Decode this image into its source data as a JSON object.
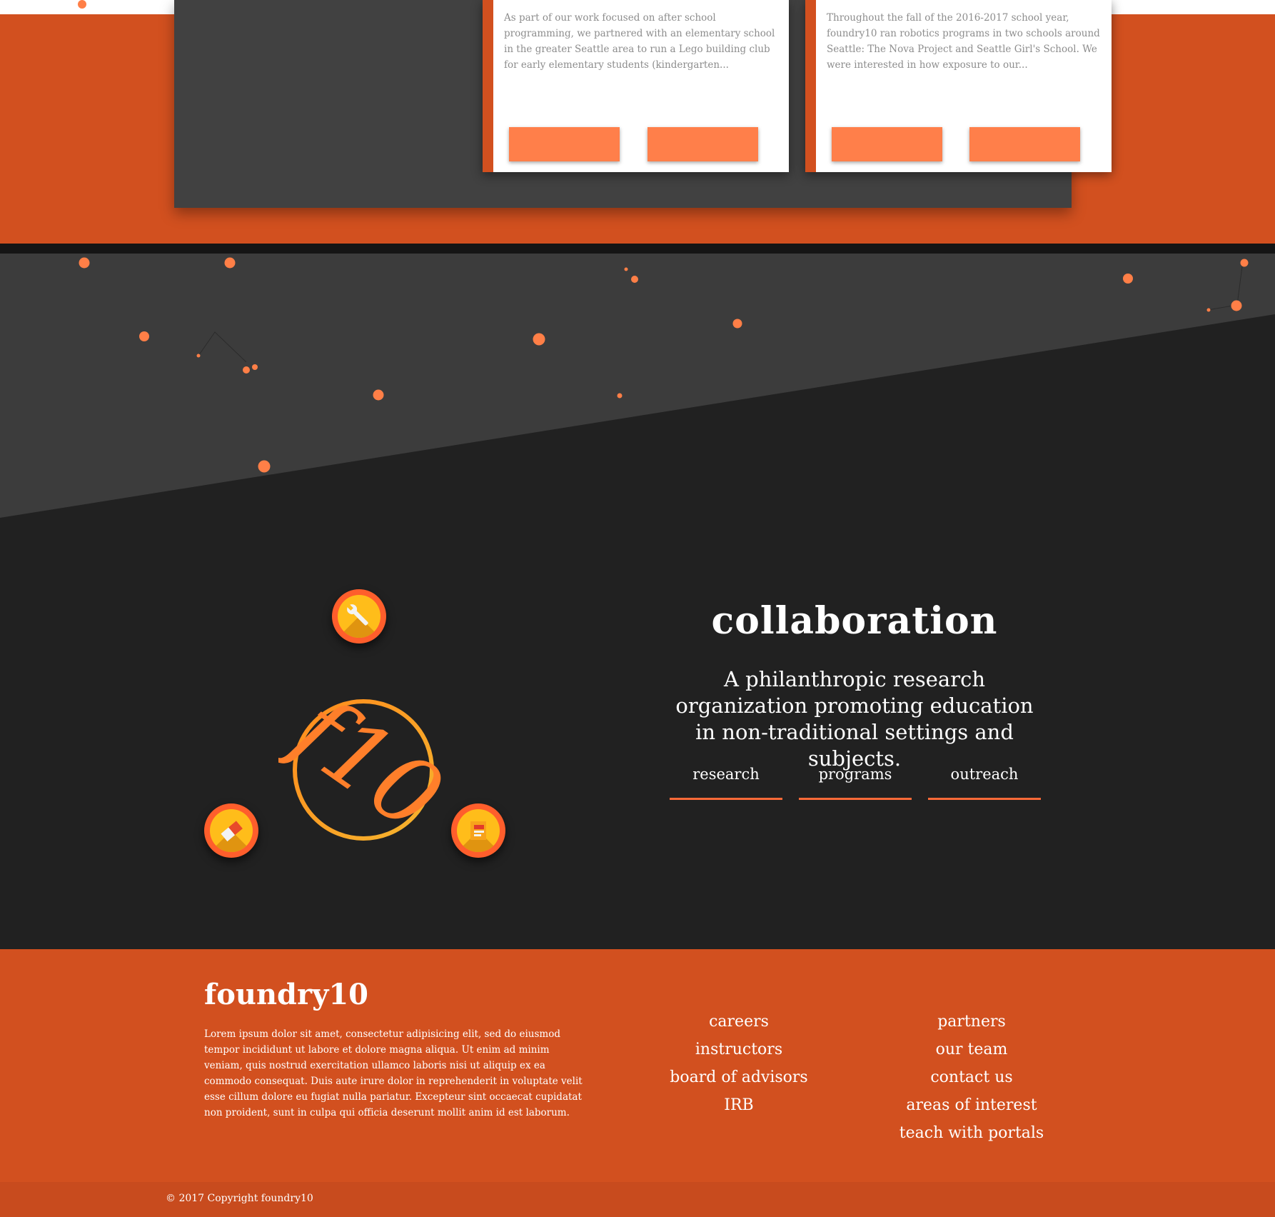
{
  "colors": {
    "brand_orange": "#d2501f",
    "accent_orange": "#ff7f4a",
    "dark_panel": "#414141",
    "background_dark": "#212121",
    "badge_yellow": "#ffbd1a"
  },
  "cards": [
    {
      "excerpt": "As part of our work focused on after school programming, we partnered with an elementary school in the greater Seattle area to run a Lego building club for early elementary students (kindergarten..."
    },
    {
      "excerpt": "Throughout the fall of the 2016-2017 school year, foundry10 ran robotics programs in two schools around Seattle: The Nova Project and Seattle Girl's School. We were interested in how exposure to our..."
    }
  ],
  "hero": {
    "title": "collaboration",
    "subtitle": "A philanthropic research organization promoting education in non-traditional settings and subjects.",
    "links": [
      "research",
      "programs",
      "outreach"
    ],
    "logo_text": "f10",
    "badge_icons": [
      "wrench-icon",
      "eraser-icon",
      "book-icon"
    ]
  },
  "footer": {
    "title": "foundry10",
    "description": "Lorem ipsum dolor sit amet, consectetur adipisicing elit, sed do eiusmod tempor incididunt ut labore et dolore magna aliqua. Ut enim ad minim veniam, quis nostrud exercitation ullamco laboris nisi ut aliquip ex ea commodo consequat. Duis aute irure dolor in reprehenderit in voluptate velit esse cillum dolore eu fugiat nulla pariatur. Excepteur sint occaecat cupidatat non proident, sunt in culpa qui officia deserunt mollit anim id est laborum.",
    "links_col1": [
      "careers",
      "instructors",
      "board of advisors",
      "IRB"
    ],
    "links_col2": [
      "partners",
      "our team",
      "contact us",
      "areas of interest",
      "teach with portals"
    ],
    "copyright": "© 2017 Copyright foundry10"
  }
}
